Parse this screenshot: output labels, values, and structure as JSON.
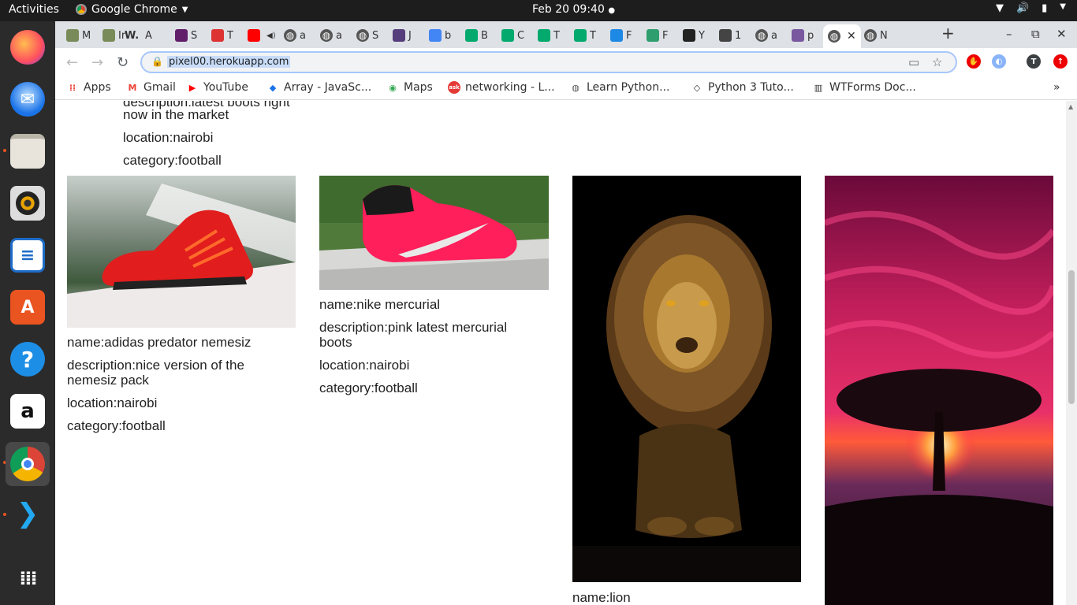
{
  "topbar": {
    "activities": "Activities",
    "app_name": "Google Chrome",
    "clock": "Feb 20  09:40"
  },
  "tabs": [
    {
      "label": "M",
      "icon": "plant-icon",
      "color": "#7a8b5a"
    },
    {
      "label": "Ir",
      "icon": "plant-icon",
      "color": "#7a8b5a"
    },
    {
      "label": "A",
      "icon": "w-logo-icon",
      "color": "#000000",
      "glyph": "W."
    },
    {
      "label": "S",
      "icon": "slack-icon",
      "color": "#611f69"
    },
    {
      "label": "T",
      "icon": "openai-icon",
      "color": "#d33"
    },
    {
      "label": "",
      "icon": "youtube-icon",
      "color": "#ff0000"
    },
    {
      "label": "a",
      "icon": "globe-icon",
      "color": "#555"
    },
    {
      "label": "a",
      "icon": "globe-icon",
      "color": "#555"
    },
    {
      "label": "S",
      "icon": "globe-icon",
      "color": "#555"
    },
    {
      "label": "J",
      "icon": "bootstrap-icon",
      "color": "#563d7c"
    },
    {
      "label": "b",
      "icon": "google-icon",
      "color": "#4285f4"
    },
    {
      "label": "B",
      "icon": "w3schools-icon",
      "color": "#04aa6d"
    },
    {
      "label": "C",
      "icon": "w3schools-icon",
      "color": "#04aa6d"
    },
    {
      "label": "T",
      "icon": "w3schools-icon",
      "color": "#04aa6d"
    },
    {
      "label": "T",
      "icon": "w3schools-icon",
      "color": "#04aa6d"
    },
    {
      "label": "F",
      "icon": "b-logo-icon",
      "color": "#1e88e5"
    },
    {
      "label": "F",
      "icon": "f-logo-icon",
      "color": "#2e9e6e"
    },
    {
      "label": "Y",
      "icon": "github-icon",
      "color": "#222"
    },
    {
      "label": "1",
      "icon": "book-icon",
      "color": "#444"
    },
    {
      "label": "a",
      "icon": "globe-icon",
      "color": "#555"
    },
    {
      "label": "p",
      "icon": "heroku-icon",
      "color": "#79589f"
    },
    {
      "label": "",
      "icon": "globe-icon",
      "color": "#555",
      "active": true
    },
    {
      "label": "N",
      "icon": "globe-icon",
      "color": "#555"
    }
  ],
  "toolbar": {
    "url": "pixel00.herokuapp.com"
  },
  "bookmarks": [
    {
      "label": "Apps",
      "icon": "apps-grid-icon"
    },
    {
      "label": "Gmail",
      "icon": "gmail-icon"
    },
    {
      "label": "YouTube",
      "icon": "youtube-icon"
    },
    {
      "label": "Array - JavaSc...",
      "icon": "mdn-icon"
    },
    {
      "label": "Maps",
      "icon": "maps-icon"
    },
    {
      "label": "networking - L...",
      "icon": "ask-icon"
    },
    {
      "label": "Learn Python...",
      "icon": "globe-icon"
    },
    {
      "label": "Python 3 Tuto...",
      "icon": "diamond-icon"
    },
    {
      "label": "WTForms Doc...",
      "icon": "book-icon"
    }
  ],
  "page": {
    "top_card": {
      "description_partial": "description:latest boots right",
      "description_cont": "now in the market",
      "location": "location:nairobi",
      "category": "category:football"
    },
    "cards": [
      {
        "name": "name:adidas predator nemesiz",
        "description_1": "description:nice version of the",
        "description_2": "nemesiz pack",
        "location": "location:nairobi",
        "category": "category:football"
      },
      {
        "name": "name:nike mercurial",
        "description_1": "description:pink latest mercurial",
        "description_2": "boots",
        "location": "location:nairobi",
        "category": "category:football"
      },
      {
        "name": "name:lion"
      }
    ]
  },
  "colors": {
    "topbar_bg": "#1d1d1d",
    "dock_bg": "#2b2b2b",
    "tabstrip_bg": "#dee1e6",
    "accent_orange": "#e95420"
  }
}
